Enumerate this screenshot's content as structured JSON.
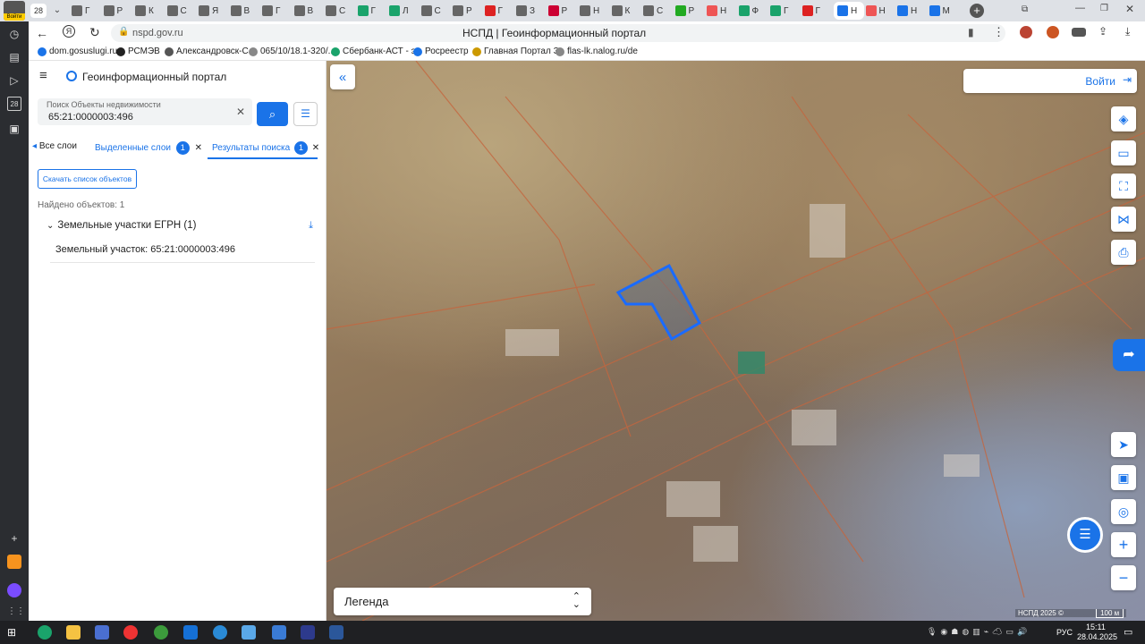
{
  "browser": {
    "tab_count": "28",
    "tabs": [
      {
        "label": "Г",
        "color": "#666"
      },
      {
        "label": "Р",
        "color": "#666"
      },
      {
        "label": "К",
        "color": "#666"
      },
      {
        "label": "С",
        "color": "#666"
      },
      {
        "label": "Я",
        "color": "#666"
      },
      {
        "label": "В",
        "color": "#666"
      },
      {
        "label": "Г",
        "color": "#666"
      },
      {
        "label": "В",
        "color": "#666"
      },
      {
        "label": "C",
        "color": "#666"
      },
      {
        "label": "Г",
        "color": "#1aa36b"
      },
      {
        "label": "Л",
        "color": "#1aa36b"
      },
      {
        "label": "С",
        "color": "#666"
      },
      {
        "label": "Р",
        "color": "#666"
      },
      {
        "label": "Г",
        "color": "#d22"
      },
      {
        "label": "З",
        "color": "#666"
      },
      {
        "label": "Р",
        "color": "#c03"
      },
      {
        "label": "Н",
        "color": "#666"
      },
      {
        "label": "К",
        "color": "#666"
      },
      {
        "label": "С",
        "color": "#666"
      },
      {
        "label": "Р",
        "color": "#2a2"
      },
      {
        "label": "Н",
        "color": "#e55"
      },
      {
        "label": "Ф",
        "color": "#1aa36b"
      },
      {
        "label": "Г",
        "color": "#1aa36b"
      },
      {
        "label": "Г",
        "color": "#d22"
      },
      {
        "label": "Н",
        "color": "#1a73e8"
      },
      {
        "label": "Н",
        "color": "#e55"
      },
      {
        "label": "Н",
        "color": "#1a73e8"
      },
      {
        "label": "М",
        "color": "#1a73e8"
      }
    ],
    "active_tab_index": 24,
    "url": "nspd.gov.ru",
    "page_title": "НСПД | Геоинформационный портал",
    "bookmarks": [
      {
        "label": "dom.gosuslugi.ru",
        "color": "#1a73e8"
      },
      {
        "label": "РСМЭВ",
        "color": "#222"
      },
      {
        "label": "Александровск-С",
        "color": "#555"
      },
      {
        "label": "065/10/18.1-320/...",
        "color": "#888"
      },
      {
        "label": "Сбербанк-АСТ - э",
        "color": "#1aa36b"
      },
      {
        "label": "Росреестр",
        "color": "#1a73e8"
      },
      {
        "label": "Главная Портал З",
        "color": "#c90"
      },
      {
        "label": "flas-lk.nalog.ru/de",
        "color": "#888"
      }
    ],
    "login_badge": "Войти"
  },
  "panel": {
    "title": "Геоинформационный портал",
    "search_label": "Поиск Объекты недвижимости",
    "search_value": "65:21:0000003:496",
    "tabs": {
      "all_layers": "Все слои",
      "selected_layers": "Выделенные слои",
      "selected_count": "1",
      "search_results": "Результаты поиска",
      "results_count": "1"
    },
    "download_button": "Скачать список объектов",
    "found_text": "Найдено объектов: 1",
    "group_label": "Земельные участки ЕГРН (1)",
    "result_item": "Земельный участок: 65:21:0000003:496"
  },
  "map": {
    "login_button": "Войти",
    "legend_label": "Легенда",
    "attribution": "НСПД 2025 ©",
    "scale": "100 м"
  },
  "taskbar": {
    "lang": "РУС",
    "time": "15:11",
    "date": "28.04.2025"
  }
}
